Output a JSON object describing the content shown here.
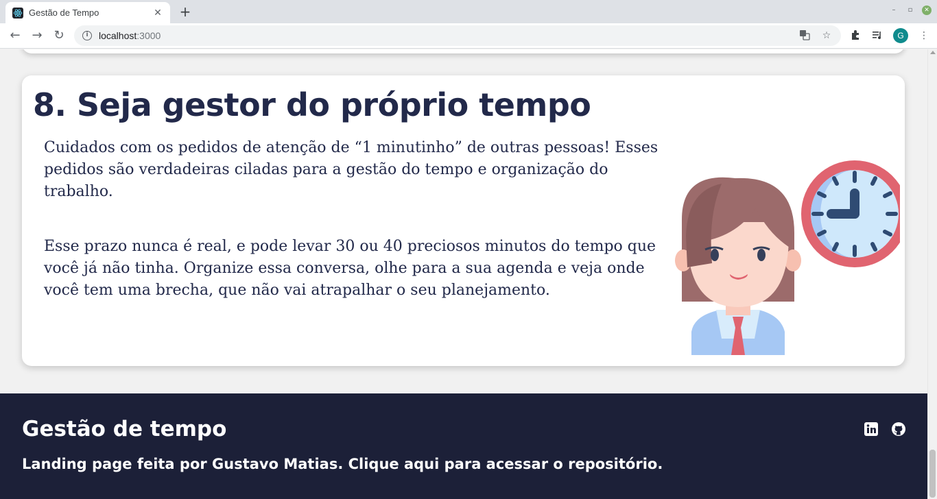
{
  "browser": {
    "tab_title": "Gestão de Tempo",
    "tab_close": "✕",
    "new_tab": "+",
    "url_host": "localhost",
    "url_port": ":3000",
    "avatar_letter": "G"
  },
  "section": {
    "title": "8. Seja gestor do próprio tempo",
    "paragraphs": [
      "Cuidados com os pedidos de atenção de “1 minutinho” de outras pessoas! Esses pedidos são verdadeiras ciladas para a gestão do tempo e organização do trabalho.",
      "Esse prazo nunca é real, e pode levar 30 ou 40 preciosos minutos do tempo que você já não tinha. Organize essa conversa, olhe para a sua agenda e veja onde você tem uma brecha, que não vai atrapalhar o seu planejamento."
    ]
  },
  "footer": {
    "title": "Gestão de tempo",
    "link_text": "Landing page feita por Gustavo Matias. Clique aqui para acessar o repositório.",
    "social": [
      "linkedin-icon",
      "github-icon"
    ]
  },
  "colors": {
    "title_text": "#22294a",
    "footer_bg": "#1c2038",
    "clock_ring": "#e06470",
    "clock_face": "#cfe8fb"
  }
}
